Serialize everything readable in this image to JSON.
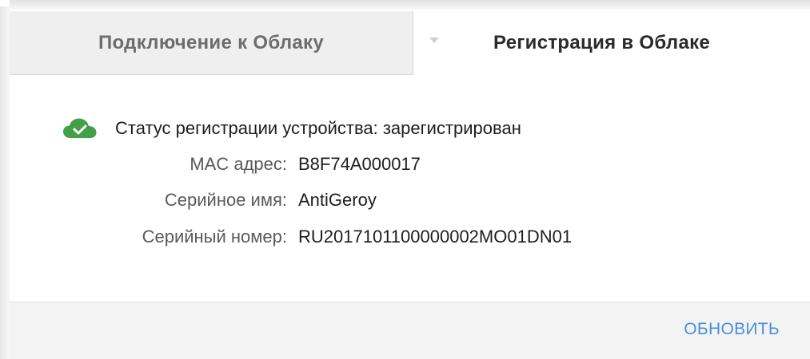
{
  "tabs": [
    {
      "label": "Подключение к Облаку",
      "active": false
    },
    {
      "label": "Регистрация в Облаке",
      "active": true
    }
  ],
  "status": {
    "icon": "cloud-check-icon",
    "icon_color": "#43a047",
    "text": "Статус регистрации устройства: зарегистрирован"
  },
  "device_info": [
    {
      "label": "MAC адрес:",
      "value": "B8F74A000017"
    },
    {
      "label": "Серийное имя:",
      "value": "AntiGeroy"
    },
    {
      "label": "Серийный номер:",
      "value": "RU2017101100000002MO01DN01"
    }
  ],
  "footer": {
    "refresh_label": "ОБНОВИТЬ",
    "accent_color": "#4a90d9"
  }
}
